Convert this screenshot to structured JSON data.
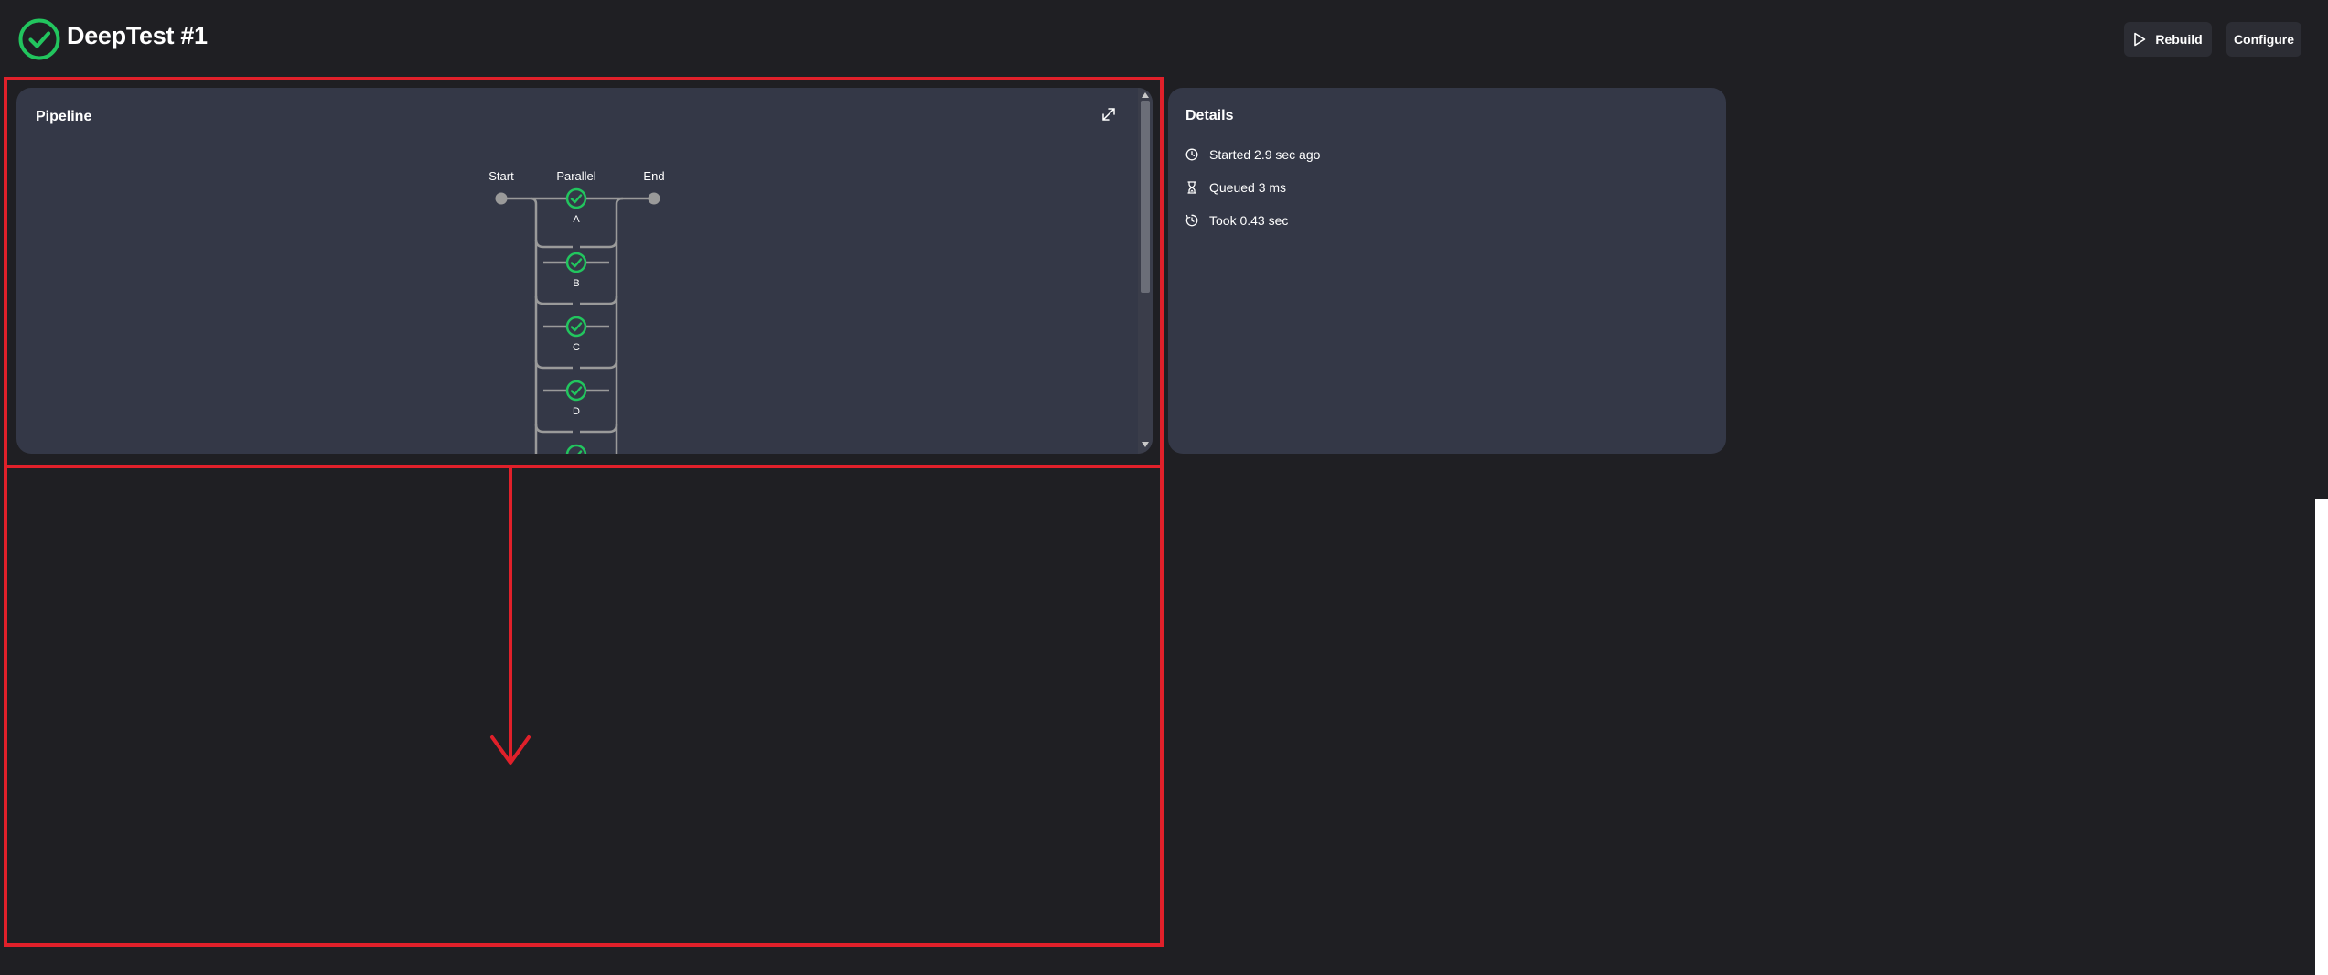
{
  "header": {
    "title": "DeepTest #1",
    "rebuild_label": "Rebuild",
    "configure_label": "Configure"
  },
  "pipeline": {
    "title": "Pipeline",
    "nodes": {
      "start": "Start",
      "parallel": "Parallel",
      "end": "End"
    },
    "stages": [
      "A",
      "B",
      "C",
      "D"
    ]
  },
  "details": {
    "title": "Details",
    "started": "Started 2.9 sec ago",
    "queued": "Queued 3 ms",
    "took": "Took 0.43 sec"
  },
  "colors": {
    "background": "#1f1f23",
    "card": "#343847",
    "success": "#22c55e",
    "connector": "#9a9a9a",
    "annotation": "#e0202a"
  },
  "icons": [
    "success-check-icon",
    "play-icon",
    "expand-icon",
    "clock-icon",
    "hourglass-icon",
    "timer-icon"
  ]
}
